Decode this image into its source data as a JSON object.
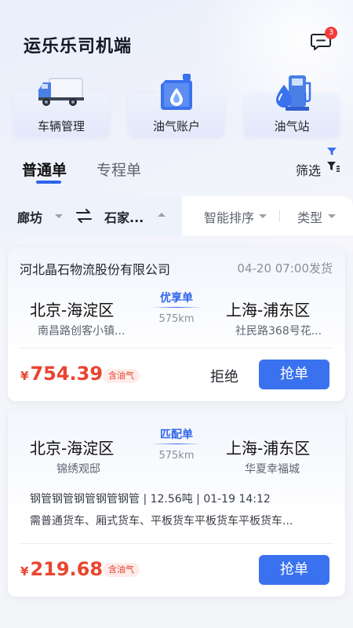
{
  "app": {
    "title": "运乐乐司机端",
    "message_badge": "3"
  },
  "quick_actions": [
    {
      "label": "车辆管理",
      "icon": "truck-icon"
    },
    {
      "label": "油气账户",
      "icon": "oil-can-icon"
    },
    {
      "label": "油气站",
      "icon": "gas-station-icon"
    }
  ],
  "tabs": {
    "active": "普通单",
    "inactive": "专程单",
    "filter_label": "筛选"
  },
  "filter_bar": {
    "origin": "廊坊",
    "destination": "石家...",
    "sort": "智能排序",
    "type": "类型"
  },
  "orders": [
    {
      "company": "河北晶石物流股份有限公司",
      "ship_time": "04-20 07:00发货",
      "from_city": "北京-海淀区",
      "from_addr": "南昌路创客小镇...",
      "tag": "优享单",
      "distance": "575km",
      "to_city": "上海-浦东区",
      "to_addr": "社民路368号花...",
      "currency": "¥",
      "price": "754.39",
      "oil_tag": "含油气",
      "reject_label": "拒绝",
      "grab_label": "抢单"
    },
    {
      "from_city": "北京-海淀区",
      "from_addr": "锦绣观邸",
      "tag": "匹配单",
      "distance": "575km",
      "to_city": "上海-浦东区",
      "to_addr": "华夏幸福城",
      "cargo_info": "钢管钢管钢管钢管钢管 | 12.56吨 | 01-19 14:12",
      "vehicle_req": "需普通货车、厢式货车、平板货车平板货车平板货车...",
      "currency": "¥",
      "price": "219.68",
      "oil_tag": "含油气",
      "grab_label": "抢单"
    }
  ],
  "colors": {
    "accent": "#3a71ee",
    "price": "#e8452f",
    "badge": "#f23b3b"
  }
}
